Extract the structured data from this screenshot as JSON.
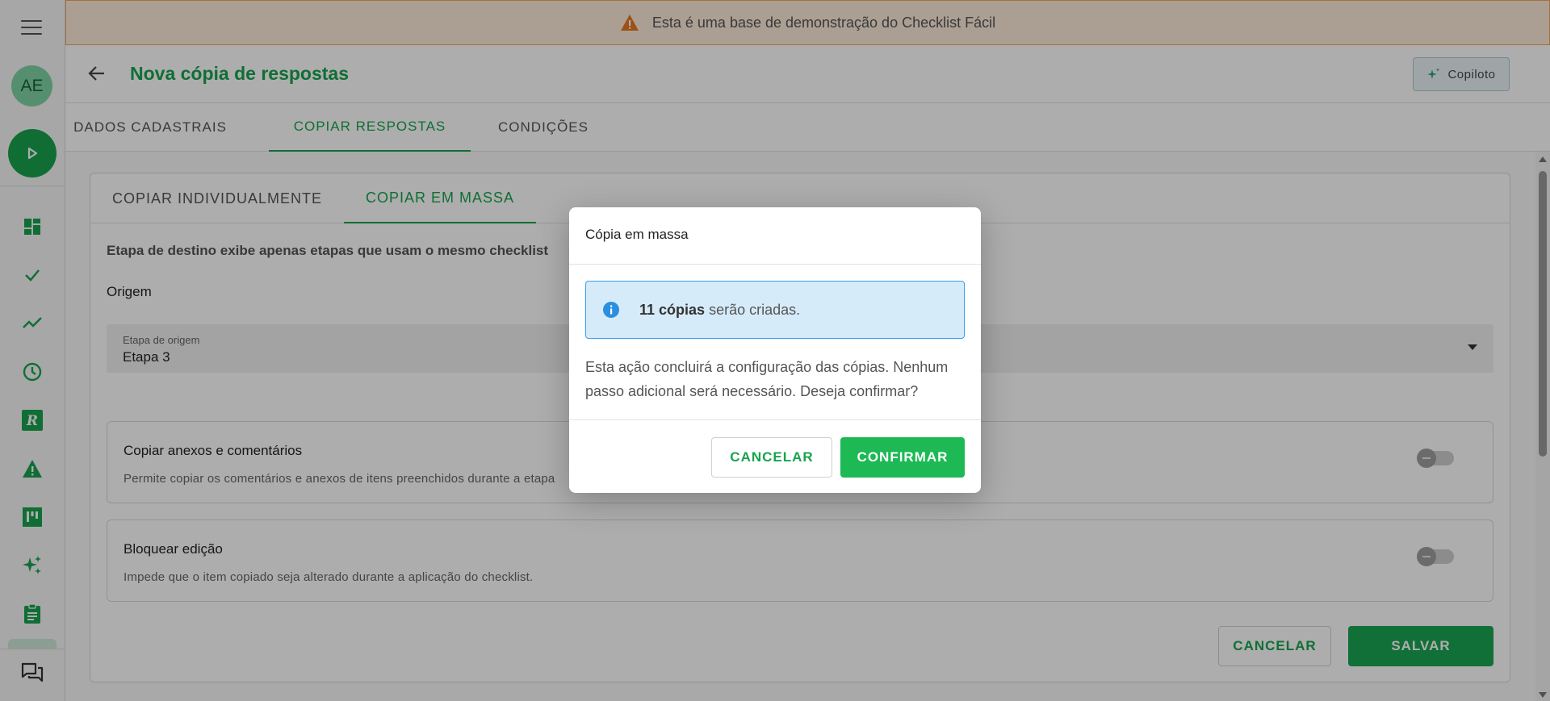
{
  "banner": {
    "text": "Esta é uma base de demonstração do Checklist Fácil"
  },
  "sidebar": {
    "avatar_initials": "AE",
    "items": [
      {
        "icon": "dashboard-icon"
      },
      {
        "icon": "check-icon"
      },
      {
        "icon": "trending-icon"
      },
      {
        "icon": "clock-icon"
      },
      {
        "icon": "r-logo-icon"
      },
      {
        "icon": "warning-icon"
      },
      {
        "icon": "board-icon"
      },
      {
        "icon": "sparkles-icon"
      },
      {
        "icon": "clipboard-icon"
      },
      {
        "icon": "chat-icon"
      }
    ]
  },
  "header": {
    "title": "Nova cópia de respostas",
    "copilot_label": "Copiloto"
  },
  "tabs": [
    {
      "label": "DADOS CADASTRAIS",
      "active": false
    },
    {
      "label": "COPIAR RESPOSTAS",
      "active": true
    },
    {
      "label": "CONDIÇÕES",
      "active": false
    }
  ],
  "subtabs": [
    {
      "label": "COPIAR INDIVIDUALMENTE",
      "active": false
    },
    {
      "label": "COPIAR EM MASSA",
      "active": true
    }
  ],
  "content": {
    "hint": "Etapa de destino exibe apenas etapas que usam o mesmo checklist",
    "origem_label": "Origem",
    "select_label": "Etapa de origem",
    "select_value": "Etapa 3",
    "options": [
      {
        "title": "Copiar anexos e comentários",
        "desc": "Permite copiar os comentários e anexos de itens preenchidos durante a etapa",
        "enabled": false
      },
      {
        "title": "Bloquear edição",
        "desc": "Impede que o item copiado seja alterado durante a aplicação do checklist.",
        "enabled": false
      }
    ],
    "cancel_label": "CANCELAR",
    "save_label": "SALVAR"
  },
  "dialog": {
    "title": "Cópia em massa",
    "info_bold": "11 cópias",
    "info_rest": "serão criadas.",
    "body": "Esta ação concluirá a configuração das cópias. Nenhum passo adicional será necessário. Deseja confirmar?",
    "cancel_label": "CANCELAR",
    "confirm_label": "CONFIRMAR"
  },
  "colors": {
    "brand_green": "#18a34f",
    "banner_bg": "#fdebd9",
    "banner_border": "#f2a35c",
    "info_bg": "#d6ebfa",
    "info_border": "#3a9ee8"
  }
}
